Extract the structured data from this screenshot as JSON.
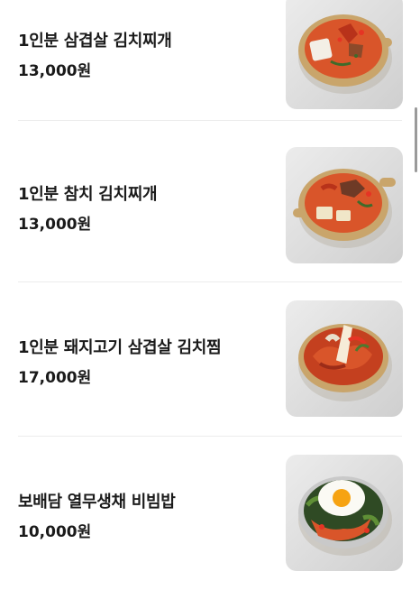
{
  "menu": {
    "items": [
      {
        "name": "1인분 삼겹살 김치찌개",
        "price": "13,000원",
        "image": "pork-belly-kimchi-stew-photo"
      },
      {
        "name": "1인분 참치 김치찌개",
        "price": "13,000원",
        "image": "tuna-kimchi-stew-photo"
      },
      {
        "name": "1인분 돼지고기 삼겹살 김치찜",
        "price": "17,000원",
        "image": "braised-kimchi-pork-photo"
      },
      {
        "name": "보배담 열무생채 비빔밥",
        "price": "10,000원",
        "image": "young-radish-bibimbap-photo"
      }
    ]
  },
  "colors": {
    "background": "#ffffff",
    "text": "#1a1a1a",
    "divider": "#ececec",
    "scrollbar": "#9a9a9a"
  }
}
